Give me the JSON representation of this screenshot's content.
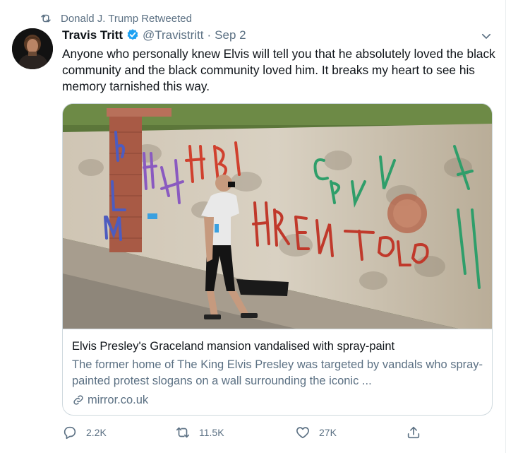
{
  "retweet_banner": {
    "icon": "retweet-icon",
    "text": "Donald J. Trump Retweeted"
  },
  "author": {
    "name": "Travis Tritt",
    "verified": true,
    "handle": "@Travistritt",
    "separator": "·",
    "date": "Sep 2"
  },
  "tweet": {
    "text": "Anyone who personally knew Elvis will tell you that he absolutely loved the black community and the black community loved him. It breaks my heart to see his memory tarnished this way."
  },
  "link_card": {
    "title": "Elvis Presley's Graceland mansion vandalised with spray-paint",
    "description": "The former home of The King Elvis Presley was targeted by vandals who spray-painted protest slogans on a wall surrounding the iconic ...",
    "domain": "mirror.co.uk",
    "link_icon": "link-icon"
  },
  "actions": {
    "reply_count": "2.2K",
    "retweet_count": "11.5K",
    "like_count": "27K",
    "share_icon": "share-icon"
  },
  "colors": {
    "text": "#0f1419",
    "secondary": "#5b7083",
    "verified": "#1da1f2",
    "border": "#cfd9de"
  }
}
